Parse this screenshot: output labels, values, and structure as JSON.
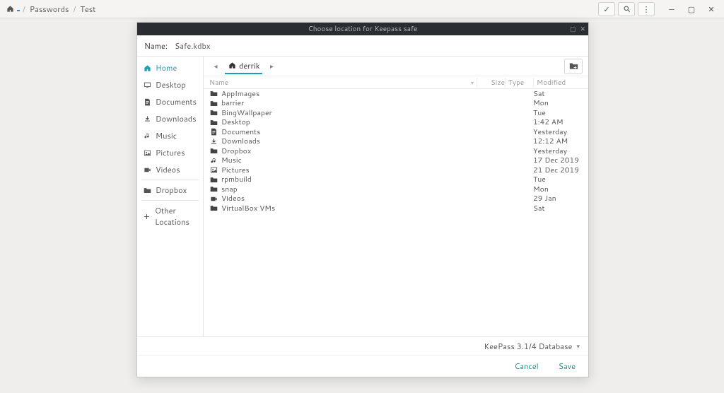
{
  "topbar": {
    "breadcrumbs": [
      "Passwords",
      "Test"
    ]
  },
  "modal": {
    "title": "Choose location for Keepass safe",
    "name_label": "Name:",
    "filename": "Safe.kdbx",
    "format": "KeePass 3.1/4 Database",
    "cancel": "Cancel",
    "save": "Save"
  },
  "sidebar": [
    {
      "icon": "home",
      "label": "Home",
      "active": true
    },
    {
      "icon": "desktop",
      "label": "Desktop"
    },
    {
      "icon": "document",
      "label": "Documents"
    },
    {
      "icon": "download",
      "label": "Downloads"
    },
    {
      "icon": "music",
      "label": "Music"
    },
    {
      "icon": "pictures",
      "label": "Pictures"
    },
    {
      "icon": "video",
      "label": "Videos"
    },
    {
      "separator": true
    },
    {
      "icon": "folder",
      "label": "Dropbox"
    },
    {
      "separator": true
    },
    {
      "icon": "plus",
      "label": "Other Locations"
    }
  ],
  "path": {
    "segment": "derrik"
  },
  "columns": {
    "name": "Name",
    "size": "Size",
    "type": "Type",
    "modified": "Modified"
  },
  "files": [
    {
      "icon": "folder",
      "name": "AppImages",
      "modified": "Sat"
    },
    {
      "icon": "folder",
      "name": "barrier",
      "modified": "Mon"
    },
    {
      "icon": "folder",
      "name": "BingWallpaper",
      "modified": "Tue"
    },
    {
      "icon": "folder",
      "name": "Desktop",
      "modified": "1:42 AM"
    },
    {
      "icon": "document",
      "name": "Documents",
      "modified": "Yesterday"
    },
    {
      "icon": "download",
      "name": "Downloads",
      "modified": "12:12 AM"
    },
    {
      "icon": "folder",
      "name": "Dropbox",
      "modified": "Yesterday"
    },
    {
      "icon": "music",
      "name": "Music",
      "modified": "17 Dec 2019"
    },
    {
      "icon": "pictures",
      "name": "Pictures",
      "modified": "21 Dec 2019"
    },
    {
      "icon": "folder",
      "name": "rpmbuild",
      "modified": "Tue"
    },
    {
      "icon": "folder",
      "name": "snap",
      "modified": "Mon"
    },
    {
      "icon": "video",
      "name": "Videos",
      "modified": "29 Jan"
    },
    {
      "icon": "folder",
      "name": "VirtualBox VMs",
      "modified": "Sat"
    }
  ]
}
